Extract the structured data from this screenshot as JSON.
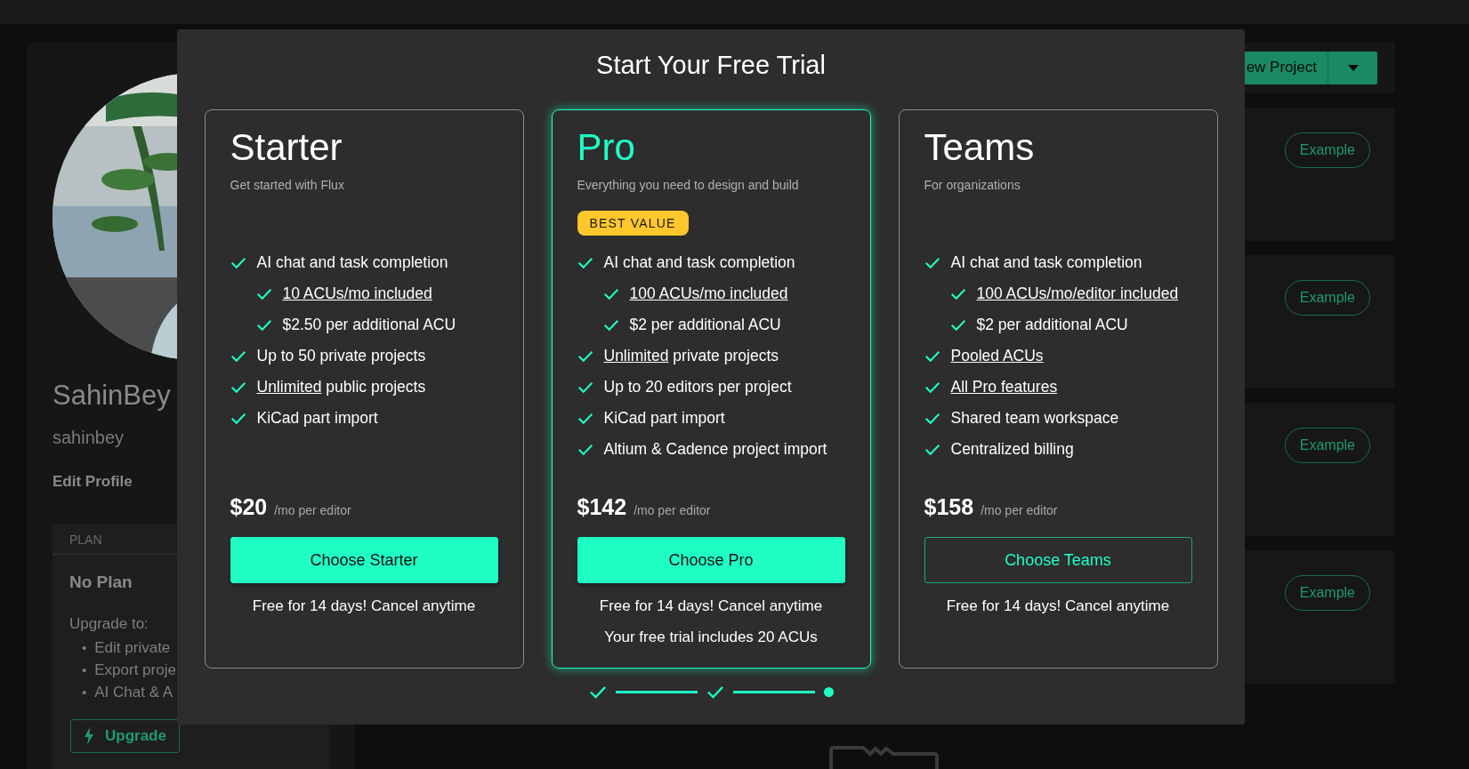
{
  "sidebar": {
    "display_name": "SahinBey",
    "username": "sahinbey",
    "edit_profile": "Edit Profile",
    "plan": {
      "header": "PLAN",
      "name": "No Plan",
      "upgrade_intro": "Upgrade to:",
      "items": [
        {
          "bullet": "•",
          "text": "Edit private"
        },
        {
          "bullet": "•",
          "text": "Export proje"
        },
        {
          "bullet": "•",
          "text": "AI Chat & A"
        }
      ],
      "upgrade_button": "Upgrade"
    }
  },
  "projects": {
    "new_project_button": "ew Project",
    "cards": [
      {
        "badge": "Example"
      },
      {
        "badge": "Example"
      },
      {
        "badge": "Example"
      },
      {
        "badge": "Example"
      }
    ]
  },
  "modal": {
    "title": "Start Your Free Trial",
    "plans": [
      {
        "name": "Starter",
        "tagline": "Get started with Flux",
        "selected": false,
        "features": [
          {
            "text": "AI chat and task completion",
            "children": [
              {
                "link": "10 ACUs/mo included"
              },
              {
                "text": "$2.50 per additional ACU"
              }
            ]
          },
          {
            "text": "Up to 50 private projects"
          },
          {
            "link": "Unlimited",
            "text": "public projects"
          },
          {
            "text": "KiCad part import"
          }
        ],
        "price": "$20",
        "price_unit": "/mo per editor",
        "button": {
          "label": "Choose Starter",
          "kind": "filled"
        },
        "notes": [
          "Free for 14 days! Cancel anytime"
        ]
      },
      {
        "name": "Pro",
        "tagline": "Everything you need to design and build",
        "selected": true,
        "badge": "BEST VALUE",
        "features": [
          {
            "text": "AI chat and task completion",
            "children": [
              {
                "link": "100 ACUs/mo included"
              },
              {
                "text": "$2 per additional ACU"
              }
            ]
          },
          {
            "link": "Unlimited",
            "text": "private projects"
          },
          {
            "text": "Up to 20 editors per project"
          },
          {
            "text": "KiCad part import"
          },
          {
            "text": "Altium & Cadence project import"
          }
        ],
        "price": "$142",
        "price_unit": "/mo per editor",
        "button": {
          "label": "Choose Pro",
          "kind": "filled"
        },
        "notes": [
          "Free for 14 days! Cancel anytime",
          "Your free trial includes 20 ACUs"
        ]
      },
      {
        "name": "Teams",
        "tagline": "For organizations",
        "selected": false,
        "features": [
          {
            "text": "AI chat and task completion",
            "children": [
              {
                "link": "100 ACUs/mo/editor included"
              },
              {
                "text": "$2 per additional ACU"
              }
            ]
          },
          {
            "link": "Pooled ACUs"
          },
          {
            "link": "All Pro features"
          },
          {
            "text": "Shared team workspace"
          },
          {
            "text": "Centralized billing"
          }
        ],
        "price": "$158",
        "price_unit": "/mo per editor",
        "button": {
          "label": "Choose Teams",
          "kind": "outline"
        },
        "notes": [
          "Free for 14 days! Cancel anytime"
        ]
      }
    ],
    "steps": [
      {
        "kind": "done"
      },
      {
        "kind": "done"
      },
      {
        "kind": "current"
      }
    ]
  }
}
